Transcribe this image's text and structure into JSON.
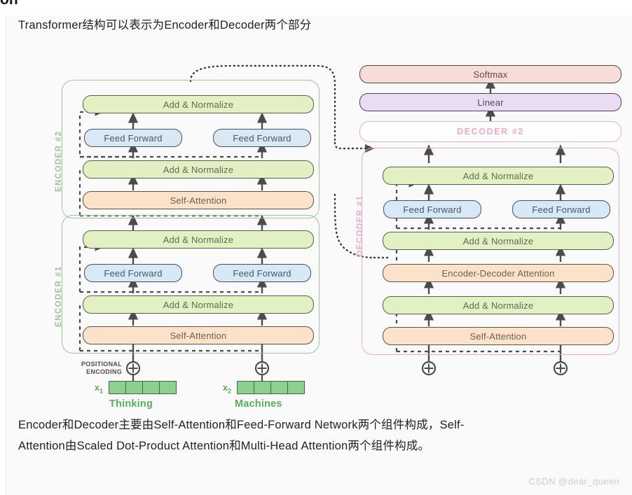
{
  "clipped_heading": "on",
  "caption_top": "Transformer结构可以表示为Encoder和Decoder两个部分",
  "caption_bottom_line1": "Encoder和Decoder主要由Self-Attention和Feed-Forward Network两个组件构成，Self-",
  "caption_bottom_line2": "Attention由Scaled Dot-Product Attention和Multi-Head Attention两个组件构成。",
  "watermark": "CSDN @dear_queen",
  "colors": {
    "add_normalize": "#e2f0c4",
    "feed_forward": "#d9e8f5",
    "attention": "#fbe2c8",
    "softmax": "#f7dcd8",
    "linear": "#eadcf2",
    "encoder_frame": "#9cc49c",
    "decoder_frame": "#efa9c7",
    "token_green": "#8ed08e",
    "word_green": "#56b156"
  },
  "diagram": {
    "encoder2": {
      "group_label": "ENCODER #2",
      "add_normalize_top": "Add & Normalize",
      "feed_forward_left": "Feed Forward",
      "feed_forward_right": "Feed Forward",
      "add_normalize_bottom": "Add & Normalize",
      "self_attention": "Self-Attention"
    },
    "encoder1": {
      "group_label": "ENCODER #1",
      "add_normalize_top": "Add & Normalize",
      "feed_forward_left": "Feed Forward",
      "feed_forward_right": "Feed Forward",
      "add_normalize_bottom": "Add & Normalize",
      "self_attention": "Self-Attention"
    },
    "decoder1": {
      "group_label": "DECODER #1",
      "add_normalize_top": "Add & Normalize",
      "feed_forward_left": "Feed Forward",
      "feed_forward_right": "Feed Forward",
      "add_normalize_mid": "Add & Normalize",
      "encoder_decoder_attention": "Encoder-Decoder Attention",
      "add_normalize_bottom": "Add & Normalize",
      "self_attention": "Self-Attention"
    },
    "decoder2_label": "DECODER #2",
    "linear": "Linear",
    "softmax": "Softmax",
    "positional_encoding_line1": "POSITIONAL",
    "positional_encoding_line2": "ENCODING",
    "plus_glyph": "⊕",
    "tokens": [
      {
        "index_label": "x",
        "index_sub": "1",
        "word": "Thinking",
        "cells": 4
      },
      {
        "index_label": "x",
        "index_sub": "2",
        "word": "Machines",
        "cells": 4
      }
    ]
  }
}
